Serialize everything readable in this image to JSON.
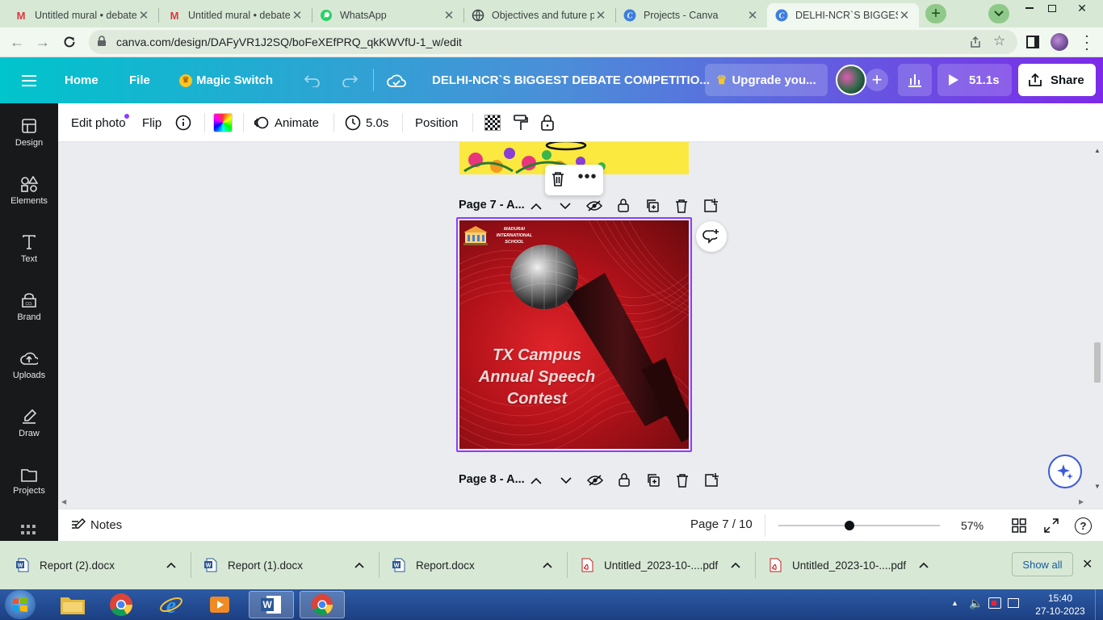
{
  "browser": {
    "tabs": [
      {
        "title": "Untitled mural • debate",
        "favicon": "mural-icon"
      },
      {
        "title": "Untitled mural • debate",
        "favicon": "mural-icon"
      },
      {
        "title": "WhatsApp",
        "favicon": "whatsapp-icon"
      },
      {
        "title": "Objectives and future p",
        "favicon": "globe-icon"
      },
      {
        "title": "Projects - Canva",
        "favicon": "canva-icon"
      },
      {
        "title": "DELHI-NCR`S BIGGEST",
        "favicon": "canva-icon"
      }
    ],
    "url": "canva.com/design/DAFyVR1J2SQ/boFeXEfPRQ_qkKWVfU-1_w/edit"
  },
  "canva": {
    "home": "Home",
    "file": "File",
    "magic_switch": "Magic Switch",
    "doc_title": "DELHI-NCR`S BIGGEST DEBATE COMPETITIO...",
    "upgrade": "Upgrade you...",
    "play_time": "51.1s",
    "share": "Share"
  },
  "toolbar": {
    "edit_photo": "Edit photo",
    "flip": "Flip",
    "animate": "Animate",
    "duration": "5.0s",
    "position": "Position"
  },
  "sidebar": {
    "items": [
      {
        "label": "Design"
      },
      {
        "label": "Elements"
      },
      {
        "label": "Text"
      },
      {
        "label": "Brand"
      },
      {
        "label": "Uploads"
      },
      {
        "label": "Draw"
      },
      {
        "label": "Projects"
      }
    ]
  },
  "pages": {
    "page7_label": "Page 7 - A...",
    "page8_label": "Page 8 - A...",
    "school": "MADURAI INTERNATIONAL SCHOOL",
    "headline": [
      "TX Campus",
      "Annual Speech",
      "Contest"
    ]
  },
  "bottom": {
    "notes": "Notes",
    "page_indicator": "Page 7 / 10",
    "zoom": "57%",
    "zoom_fraction": 0.44
  },
  "downloads": {
    "items": [
      {
        "name": "Report (2).docx",
        "type": "word"
      },
      {
        "name": "Report (1).docx",
        "type": "word"
      },
      {
        "name": "Report.docx",
        "type": "word"
      },
      {
        "name": "Untitled_2023-10-....pdf",
        "type": "pdf"
      },
      {
        "name": "Untitled_2023-10-....pdf",
        "type": "pdf"
      }
    ],
    "show_all": "Show all"
  },
  "taskbar": {
    "time": "15:40",
    "date": "27-10-2023"
  },
  "colors": {
    "canva_gradient_start": "#00c4cc",
    "canva_gradient_end": "#7c2ae8",
    "selection": "#8b3dff",
    "poster_red": "#c4141a"
  }
}
